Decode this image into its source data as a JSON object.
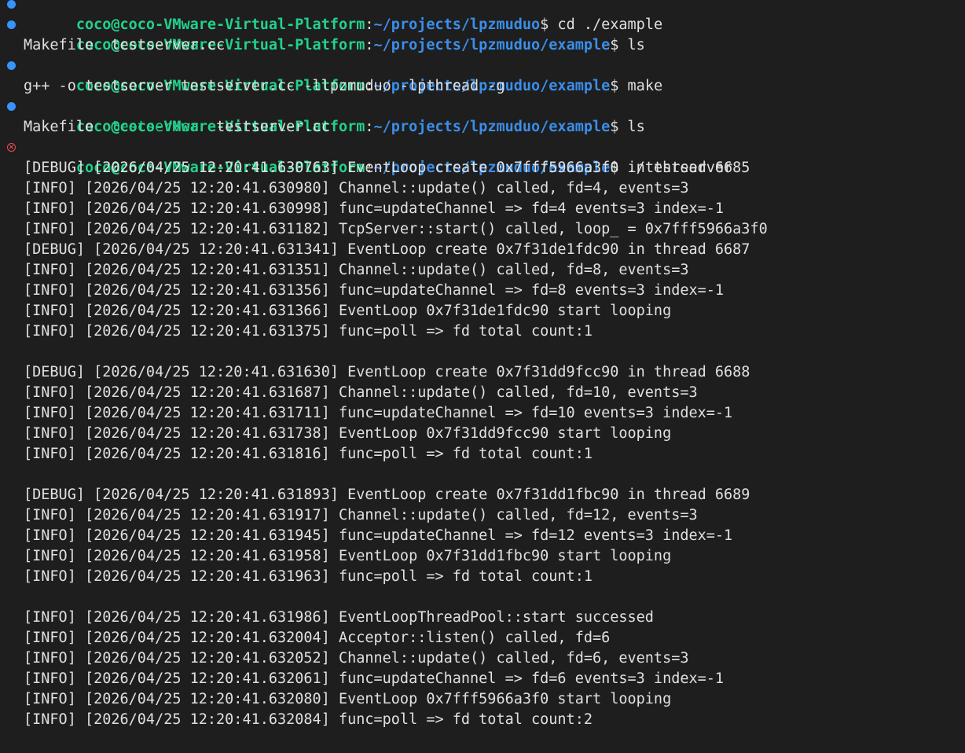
{
  "colors": {
    "background": "#1e1e1e",
    "user_host": "#23d18b",
    "path": "#3b8eea",
    "text": "#e0e0e0",
    "success_marker": "#3794ff",
    "error_marker": "#f14c4c"
  },
  "prompts": [
    {
      "status": "success-dot-icon",
      "user_host": "coco@coco-VMware-Virtual-Platform",
      "colon": ":",
      "path": "~/projects/lpzmuduo",
      "sigil": "$ ",
      "command": "cd ./example"
    },
    {
      "status": "success-dot-icon",
      "user_host": "coco@coco-VMware-Virtual-Platform",
      "colon": ":",
      "path": "~/projects/lpzmuduo/example",
      "sigil": "$ ",
      "command": "ls"
    },
    {
      "status": "success-dot-icon",
      "user_host": "coco@coco-VMware-Virtual-Platform",
      "colon": ":",
      "path": "~/projects/lpzmuduo/example",
      "sigil": "$ ",
      "command": "make"
    },
    {
      "status": "success-dot-icon",
      "user_host": "coco@coco-VMware-Virtual-Platform",
      "colon": ":",
      "path": "~/projects/lpzmuduo/example",
      "sigil": "$ ",
      "command": "ls"
    },
    {
      "status": "error-circle-icon",
      "user_host": "coco@coco-VMware-Virtual-Platform",
      "colon": ":",
      "path": "~/projects/lpzmuduo/example",
      "sigil": "$ ",
      "command": "./testserver"
    }
  ],
  "ls1": {
    "f1": "Makefile",
    "gap": "  ",
    "f2": "testserver.cc"
  },
  "make_output": "g++ -o testserver testserver.cc -llpzmuduo -lpthread -g",
  "ls2": {
    "f1": "Makefile",
    "gap1": "  ",
    "f2": "testserver",
    "gap2": "  ",
    "f3": "testserver.cc"
  },
  "log": [
    "[DEBUG] [2026/04/25 12:20:41.630763] EventLoop create 0x7fff5966a3f0 in thread 6685",
    "[INFO] [2026/04/25 12:20:41.630980] Channel::update() called, fd=4, events=3",
    "[INFO] [2026/04/25 12:20:41.630998] func=updateChannel => fd=4 events=3 index=-1",
    "[INFO] [2026/04/25 12:20:41.631182] TcpServer::start() called, loop_ = 0x7fff5966a3f0",
    "[DEBUG] [2026/04/25 12:20:41.631341] EventLoop create 0x7f31de1fdc90 in thread 6687",
    "[INFO] [2026/04/25 12:20:41.631351] Channel::update() called, fd=8, events=3",
    "[INFO] [2026/04/25 12:20:41.631356] func=updateChannel => fd=8 events=3 index=-1",
    "[INFO] [2026/04/25 12:20:41.631366] EventLoop 0x7f31de1fdc90 start looping",
    "[INFO] [2026/04/25 12:20:41.631375] func=poll => fd total count:1",
    "",
    "[DEBUG] [2026/04/25 12:20:41.631630] EventLoop create 0x7f31dd9fcc90 in thread 6688",
    "[INFO] [2026/04/25 12:20:41.631687] Channel::update() called, fd=10, events=3",
    "[INFO] [2026/04/25 12:20:41.631711] func=updateChannel => fd=10 events=3 index=-1",
    "[INFO] [2026/04/25 12:20:41.631738] EventLoop 0x7f31dd9fcc90 start looping",
    "[INFO] [2026/04/25 12:20:41.631816] func=poll => fd total count:1",
    "",
    "[DEBUG] [2026/04/25 12:20:41.631893] EventLoop create 0x7f31dd1fbc90 in thread 6689",
    "[INFO] [2026/04/25 12:20:41.631917] Channel::update() called, fd=12, events=3",
    "[INFO] [2026/04/25 12:20:41.631945] func=updateChannel => fd=12 events=3 index=-1",
    "[INFO] [2026/04/25 12:20:41.631958] EventLoop 0x7f31dd1fbc90 start looping",
    "[INFO] [2026/04/25 12:20:41.631963] func=poll => fd total count:1",
    "",
    "[INFO] [2026/04/25 12:20:41.631986] EventLoopThreadPool::start successed",
    "[INFO] [2026/04/25 12:20:41.632004] Acceptor::listen() called, fd=6",
    "[INFO] [2026/04/25 12:20:41.632052] Channel::update() called, fd=6, events=3",
    "[INFO] [2026/04/25 12:20:41.632061] func=updateChannel => fd=6 events=3 index=-1",
    "[INFO] [2026/04/25 12:20:41.632080] EventLoop 0x7fff5966a3f0 start looping",
    "[INFO] [2026/04/25 12:20:41.632084] func=poll => fd total count:2"
  ]
}
